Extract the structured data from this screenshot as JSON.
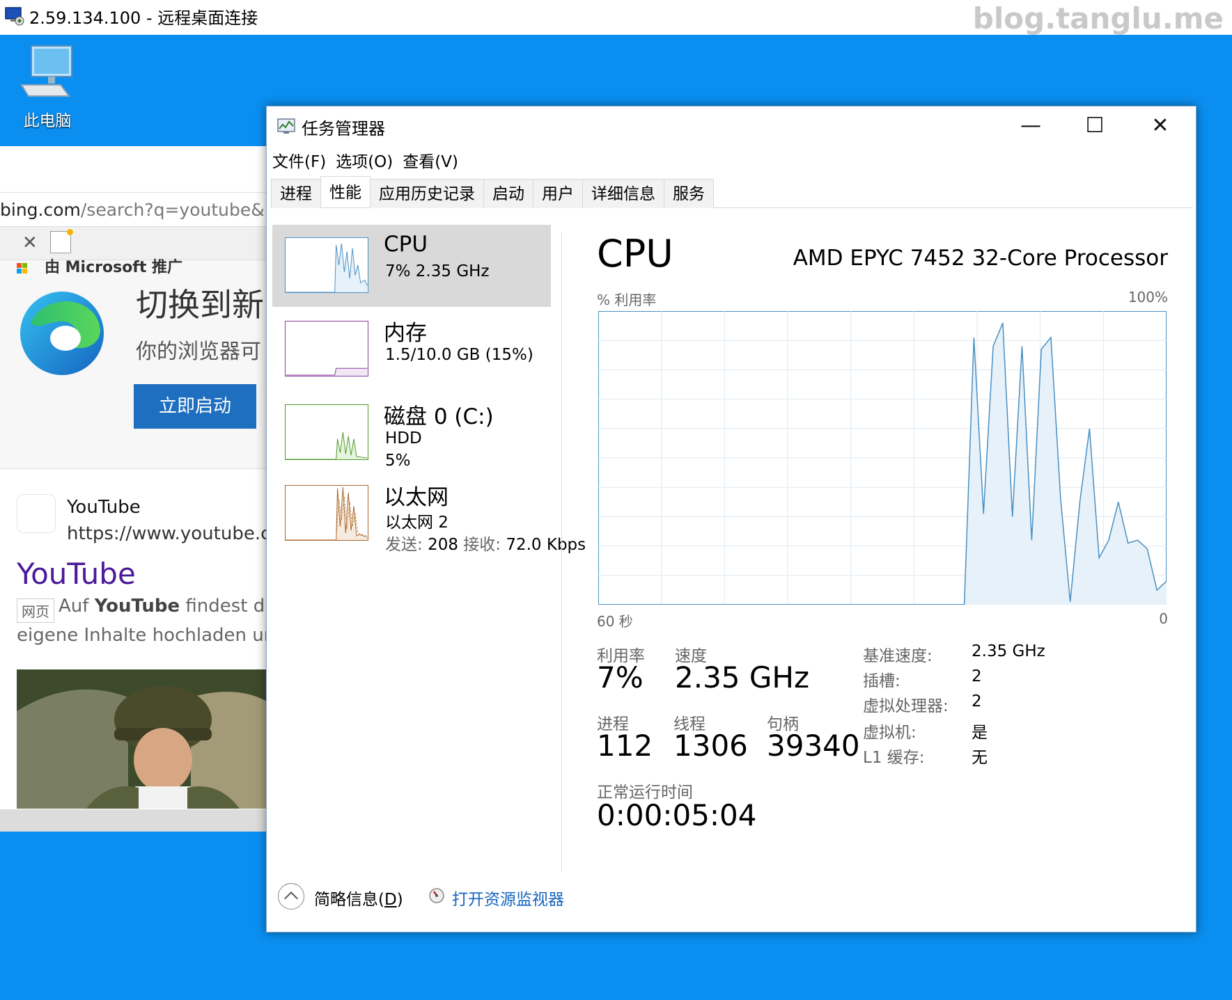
{
  "rdp": {
    "title": "2.59.134.100 - 远程桌面连接",
    "watermark": "blog.tanglu.me"
  },
  "desktop": {
    "icon_label": "此电脑"
  },
  "browser": {
    "url_host": "bing.com",
    "url_path": "/search?q=youtube&FORM",
    "ms_text": "由 Microsoft 推广",
    "ad_title": "切换到新",
    "ad_sub": "你的浏览器可",
    "ad_button": "立即启动",
    "site_name": "YouTube",
    "site_url": "https://www.youtube.com",
    "result_title": "YouTube",
    "result_tag": "网页",
    "desc_pre": "Auf ",
    "desc_bold": "YouTube",
    "desc_post": " findest du",
    "desc_line2": "eigene Inhalte hochladen und"
  },
  "tm": {
    "title": "任务管理器",
    "win_min": "—",
    "win_max": "☐",
    "win_close": "✕",
    "menu": [
      "文件(F)",
      "选项(O)",
      "查看(V)"
    ],
    "tabs": [
      "进程",
      "性能",
      "应用历史记录",
      "启动",
      "用户",
      "详细信息",
      "服务"
    ],
    "active_tab": "性能",
    "resources": {
      "cpu": {
        "name": "CPU",
        "line1": "7%  2.35 GHz"
      },
      "mem": {
        "name": "内存",
        "line1": "1.5/10.0 GB (15%)"
      },
      "disk": {
        "name": "磁盘 0 (C:)",
        "line1": "HDD",
        "line2": "5%"
      },
      "net": {
        "name": "以太网",
        "line1": "以太网 2",
        "send_label": "发送:",
        "send_val": "208",
        "recv_label": "接收:",
        "recv_val": "72.0 Kbps"
      }
    },
    "panel": {
      "title": "CPU",
      "model": "AMD EPYC 7452 32-Core Processor",
      "y_label": "% 利用率",
      "y_max": "100%",
      "x_left": "60 秒",
      "x_right": "0",
      "stats": {
        "util_label": "利用率",
        "util_val": "7%",
        "speed_label": "速度",
        "speed_val": "2.35 GHz",
        "proc_label": "进程",
        "proc_val": "112",
        "thread_label": "线程",
        "thread_val": "1306",
        "handle_label": "句柄",
        "handle_val": "39340",
        "uptime_label": "正常运行时间",
        "uptime_val": "0:00:05:04"
      },
      "details": [
        {
          "k": "基准速度:",
          "v": "2.35 GHz"
        },
        {
          "k": "插槽:",
          "v": "2"
        },
        {
          "k": "虚拟处理器:",
          "v": "2"
        },
        {
          "k": "虚拟机:",
          "v": "是"
        },
        {
          "k": "L1 缓存:",
          "v": "无"
        }
      ]
    },
    "footer": {
      "less_prefix": "简略信息(",
      "less_key": "D",
      "less_suffix": ")",
      "monitor": "打开资源监视器"
    }
  },
  "cpu_history": [
    0,
    0,
    0,
    0,
    0,
    0,
    0,
    0,
    0,
    0,
    0,
    0,
    0,
    0,
    0,
    0,
    0,
    0,
    0,
    0,
    0,
    0,
    0,
    0,
    0,
    0,
    0,
    0,
    0,
    0,
    0,
    0,
    0,
    0,
    0,
    0,
    0,
    0,
    0,
    91,
    31,
    88,
    96,
    30,
    88,
    22,
    87,
    91,
    36,
    1,
    35,
    60,
    16,
    22,
    35,
    21,
    22,
    19,
    5,
    8
  ]
}
